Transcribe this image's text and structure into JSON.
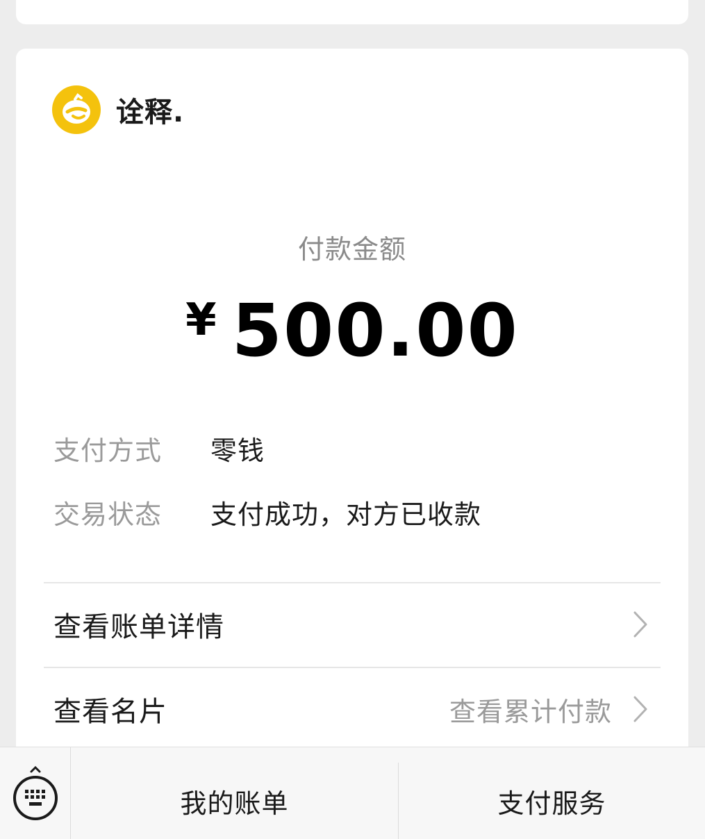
{
  "merchant": {
    "name": "诠释."
  },
  "payment": {
    "amount_label": "付款金额",
    "currency_symbol": "¥",
    "amount": "500.00"
  },
  "details": [
    {
      "label": "支付方式",
      "value": "零钱"
    },
    {
      "label": "交易状态",
      "value": "支付成功，对方已收款"
    }
  ],
  "links": {
    "bill_details": "查看账单详情",
    "view_card": "查看名片",
    "view_total": "查看累计付款"
  },
  "bottom_menu": {
    "my_bills": "我的账单",
    "pay_service": "支付服务"
  },
  "colors": {
    "avatar": "#f4c20d",
    "background": "#ededed"
  }
}
